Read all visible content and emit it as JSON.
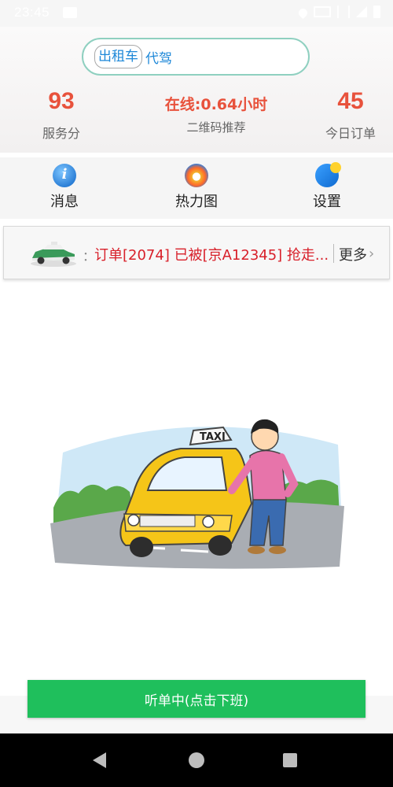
{
  "status_bar": {
    "time": "23:45"
  },
  "mode_switch": {
    "options": [
      "出租车",
      "代驾"
    ]
  },
  "stats": {
    "service_score": {
      "value": "93",
      "label": "服务分"
    },
    "online": {
      "text": "在线:0.64小时",
      "sub_label": "二维码推荐"
    },
    "today_orders": {
      "value": "45",
      "label": "今日订单"
    }
  },
  "actions": [
    {
      "label": "消息",
      "icon": "info-icon"
    },
    {
      "label": "热力图",
      "icon": "heatmap-icon"
    },
    {
      "label": "设置",
      "icon": "settings-icon"
    }
  ],
  "notice": {
    "separator": "：",
    "message": "订单[2074] 已被[京A12345] 抢走...",
    "more": "更多"
  },
  "bottom_button": {
    "label": "听单中(点击下班)",
    "color": "#1fbf5c"
  },
  "colors": {
    "accent_red": "#e8523c",
    "notice_red": "#d8202a",
    "blue": "#1e88d8"
  }
}
